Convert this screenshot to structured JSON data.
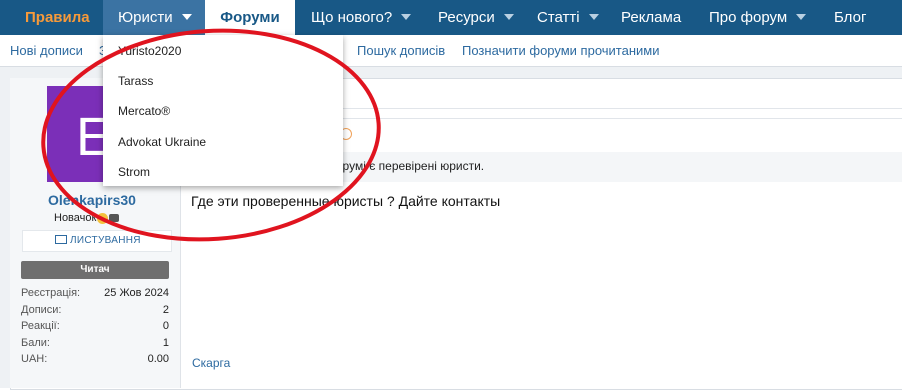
{
  "topnav": {
    "items": [
      {
        "label": "Правила"
      },
      {
        "label": "Юристи"
      },
      {
        "label": "Форуми"
      },
      {
        "label": "Що нового?"
      },
      {
        "label": "Ресурси"
      },
      {
        "label": "Статті"
      },
      {
        "label": "Реклама"
      },
      {
        "label": "Про форум"
      },
      {
        "label": "Блог"
      }
    ]
  },
  "subnav": {
    "items": [
      {
        "label": "Нові дописи"
      },
      {
        "label": "З"
      },
      {
        "label": "Пошук дописів"
      },
      {
        "label": "Позначити форуми прочитаними"
      }
    ]
  },
  "dropdown": {
    "items": [
      {
        "label": "Yuristo2020"
      },
      {
        "label": "Tarass"
      },
      {
        "label": "Mercato®"
      },
      {
        "label": "Advokat Ukraine"
      },
      {
        "label": "Strom"
      }
    ]
  },
  "user": {
    "avatar_letter": "E",
    "avatar_color": "#7b2fb8",
    "name": "Olenkapirs30",
    "title": "Новачок",
    "message_button": "ЛИСТУВАННЯ",
    "role": "Читач",
    "stats": [
      {
        "label": "Реєстрація:",
        "value": "25 Жов 2024"
      },
      {
        "label": "Дописи:",
        "value": "2"
      },
      {
        "label": "Реакції:",
        "value": "0"
      },
      {
        "label": "Бали:",
        "value": "1"
      },
      {
        "label": "UAH:",
        "value": "0.00"
      }
    ]
  },
  "post": {
    "quote_text": "форумі є перевірені юристи.",
    "body": "Где эти проверенные юристы ? Дайте контакты",
    "report_label": "Скарга"
  },
  "colors": {
    "nav_bg": "#185886",
    "rules_orange": "#f79a3a",
    "link_blue": "#2d6aa0",
    "annotation_red": "#e0141f"
  }
}
